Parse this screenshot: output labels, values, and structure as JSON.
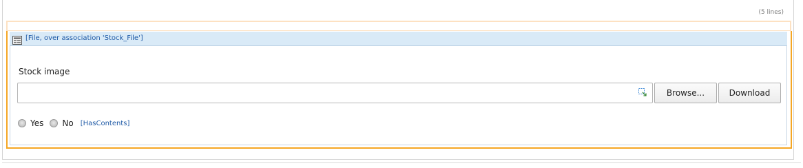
{
  "list": {
    "line_count": "(5 lines)"
  },
  "section": {
    "header": "[File, over association 'Stock_File']",
    "icon": "form-icon"
  },
  "field": {
    "label": "Stock image",
    "value": "",
    "input_icon": "file-link-icon"
  },
  "buttons": {
    "browse": "Browse...",
    "download": "Download"
  },
  "has_contents": {
    "yes_label": "Yes",
    "no_label": "No",
    "tag": "[HasContents]"
  },
  "colors": {
    "accent_orange": "#f5a623",
    "header_blue_bg": "#d9eaf7",
    "link_blue": "#1f5aa6"
  }
}
